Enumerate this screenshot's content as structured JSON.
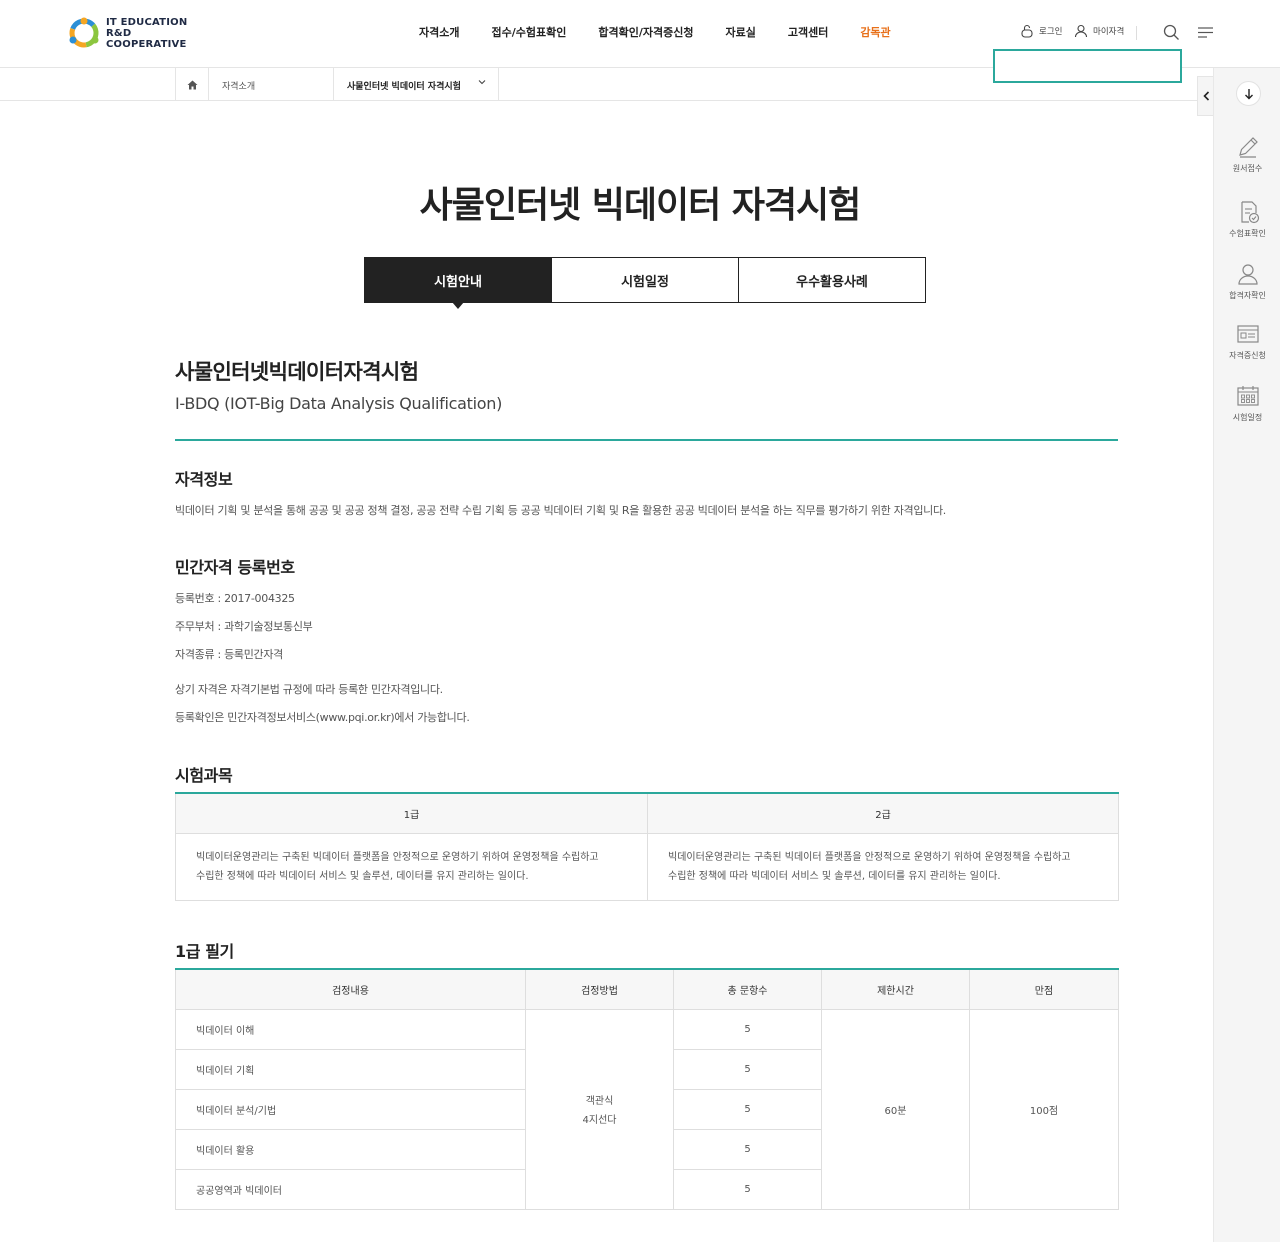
{
  "header": {
    "logo": {
      "line1": "IT EDUCATION",
      "line2": "R&D COOPERATIVE"
    },
    "nav": [
      "자격소개",
      "접수/수험표확인",
      "합격확인/자격증신청",
      "자료실",
      "고객센터",
      "감독관"
    ],
    "active_nav_color": "#e8701a",
    "util": {
      "login": "로그인",
      "mypage": "마이자격"
    }
  },
  "breadcrumb": {
    "level1": "자격소개",
    "level2": "사물인터넷 빅데이터 자격시험"
  },
  "side_menu": {
    "items": [
      {
        "label": "원서접수",
        "icon": "pencil-icon"
      },
      {
        "label": "수험표확인",
        "icon": "document-check-icon"
      },
      {
        "label": "합격자확인",
        "icon": "person-icon"
      },
      {
        "label": "자격증신청",
        "icon": "certificate-icon"
      },
      {
        "label": "시험일정",
        "icon": "calendar-icon"
      }
    ]
  },
  "page": {
    "title": "사물인터넷 빅데이터 자격시험",
    "tabs": [
      "시험안내",
      "시험일정",
      "우수활용사례"
    ],
    "active_tab": 0
  },
  "qual": {
    "title": "사물인터넷빅데이터자격시험",
    "subtitle": "I-BDQ (IOT-Big Data Analysis Qualification)"
  },
  "info": {
    "heading": "자격정보",
    "text": "빅데이터 기획 및 분석을 통해 공공 및 공공 정책 결정, 공공 전략 수립 기획 등 공공 빅데이터 기획 및 R을 활용한 공공 빅데이터 분석을 하는 직무를 평가하기 위한 자격입니다."
  },
  "registration": {
    "heading": "민간자격 등록번호",
    "lines": [
      "등록번호 : 2017-004325",
      "주무부처 : 과학기술정보통신부",
      "자격종류 : 등록민간자격"
    ],
    "notes": [
      "상기 자격은 자격기본법 규정에 따라 등록한 민간자격입니다.",
      "등록확인은 민간자격정보서비스(www.pqi.or.kr)에서 가능합니다."
    ]
  },
  "subjects": {
    "heading": "시험과목",
    "columns": [
      "1급",
      "2급"
    ],
    "cells": [
      [
        "빅데이터운영관리는 구축된 빅데이터 플랫폼을 안정적으로 운영하기 위하여 운영정책을 수립하고",
        "수립한 정책에 따라 빅데이터 서비스 및 솔루션, 데이터를 유지 관리하는 일이다."
      ],
      [
        "빅데이터운영관리는 구축된 빅데이터 플랫폼을 안정적으로 운영하기 위하여 운영정책을 수립하고",
        "수립한 정책에 따라 빅데이터 서비스 및 솔루션, 데이터를 유지 관리하는 일이다."
      ]
    ]
  },
  "written": {
    "heading": "1급 필기",
    "columns": [
      "검정내용",
      "검정방법",
      "총 문항수",
      "제한시간",
      "만점"
    ],
    "rows": [
      {
        "content": "빅데이터 이해",
        "count": "5"
      },
      {
        "content": "빅데이터 기획",
        "count": "5"
      },
      {
        "content": "빅데이터 분석/기법",
        "count": "5"
      },
      {
        "content": "빅데이터 활용",
        "count": "5"
      },
      {
        "content": "공공영역과 빅데이터",
        "count": "5"
      }
    ],
    "method": [
      "객관식",
      "4지선다"
    ],
    "time": "60분",
    "score": "100점"
  },
  "colors": {
    "accent": "#2ba89c",
    "dark": "#222222"
  }
}
